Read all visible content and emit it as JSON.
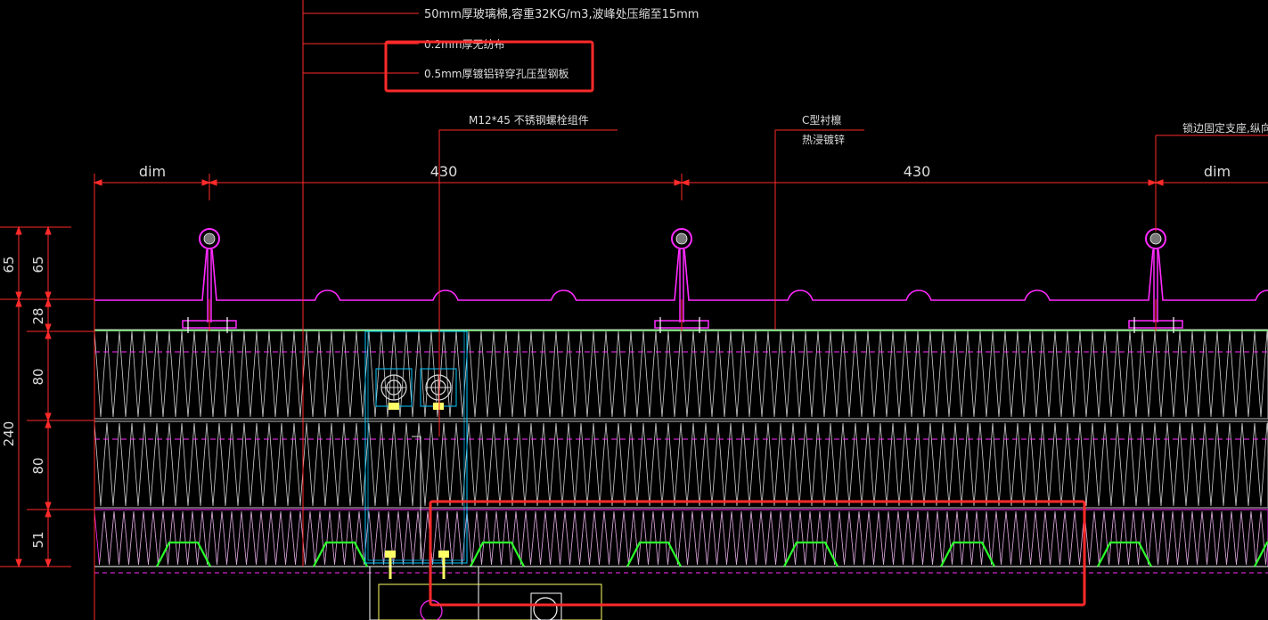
{
  "notes": {
    "insulation": "50mm厚玻璃棉,容重32KG/m3,波峰处压缩至15mm",
    "film": "0.2mm厚无纺布",
    "deck": "0.5mm厚镀铝锌穿孔压型钢板",
    "bolt": "M12*45 不锈钢螺栓组件",
    "purlin_line1": "C型衬檩",
    "purlin_line2": "热浸镀锌",
    "clip": "锁边固定支座,纵向间距"
  },
  "top_dims": {
    "left_dim": "dim",
    "span1": "430",
    "span2": "430",
    "right_dim": "dim"
  },
  "left_dims": {
    "outer_top": "65",
    "outer_total": "240",
    "d65": "65",
    "d28": "28",
    "d80a": "80",
    "d80b": "80",
    "d51": "51"
  },
  "colors": {
    "panel": "#ff2bff",
    "insulation": "#d9d9d9",
    "dim": "#ff2a2a",
    "deck": "#2bff2b",
    "bolt": "#00c8ff",
    "highlight": "#ff2a2a",
    "hardware": "#ffff66"
  }
}
